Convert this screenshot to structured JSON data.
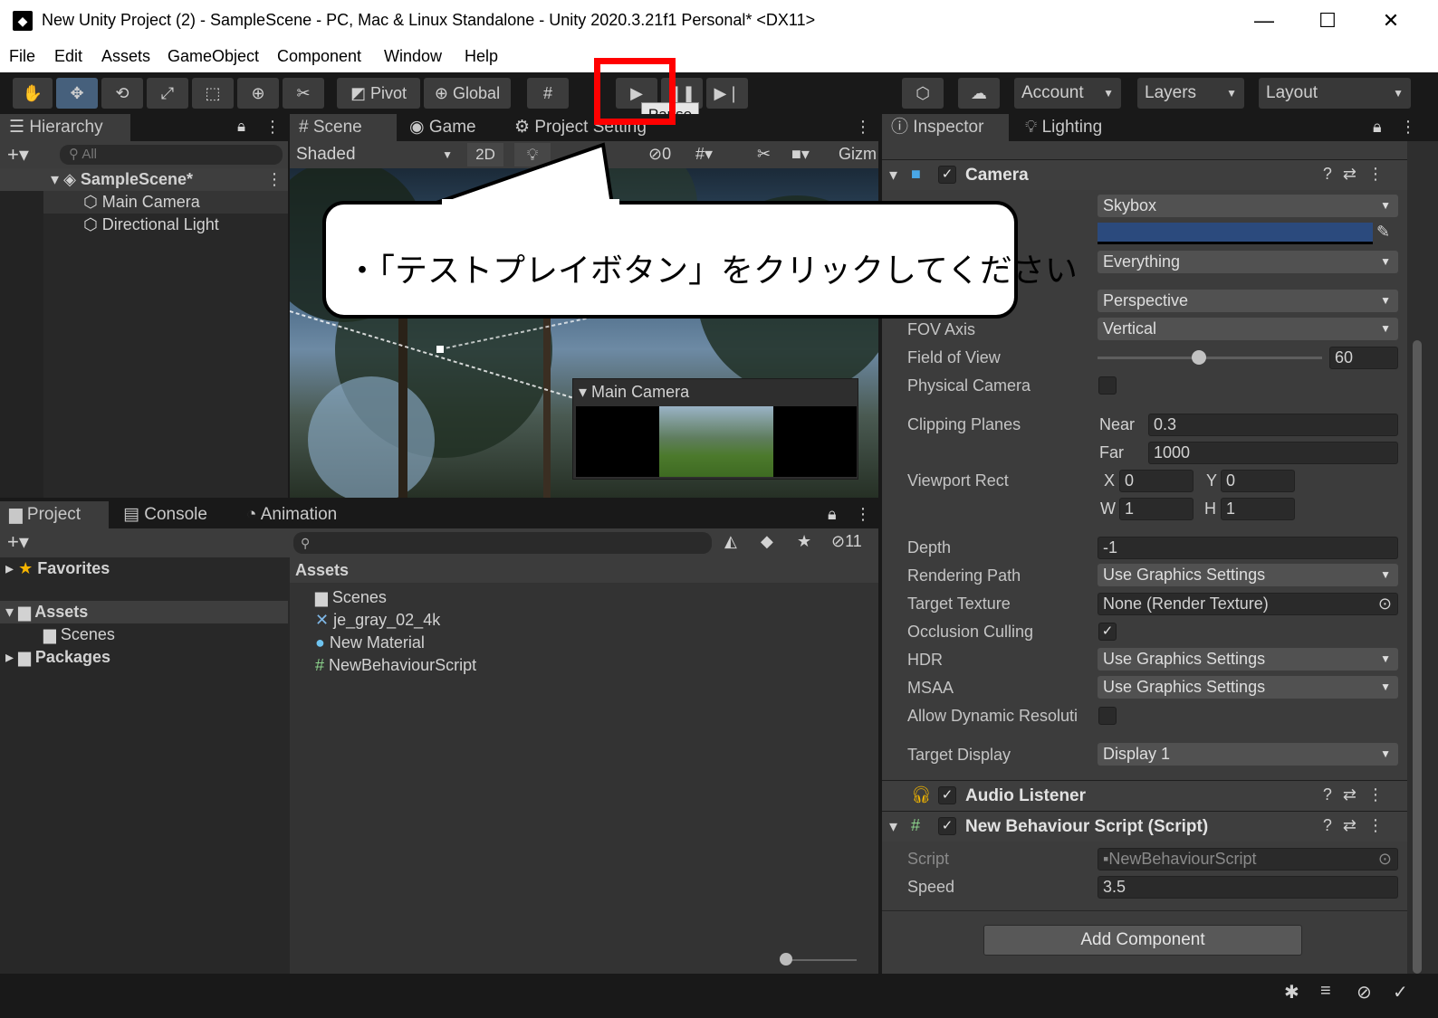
{
  "window": {
    "title": "New Unity Project (2) - SampleScene - PC, Mac & Linux Standalone - Unity 2020.3.21f1 Personal* <DX11>",
    "controls": [
      "—",
      "☐",
      "✕"
    ]
  },
  "menu": [
    "File",
    "Edit",
    "Assets",
    "GameObject",
    "Component",
    "Window",
    "Help"
  ],
  "toolbar": {
    "pivot": "Pivot",
    "global": "Global",
    "tooltip": "Pause",
    "account": "Account",
    "layers": "Layers",
    "layout": "Layout"
  },
  "hierarchy": {
    "tab": "Hierarchy",
    "search_placeholder": "All",
    "scene": "SampleScene*",
    "items": [
      "Main Camera",
      "Directional Light"
    ]
  },
  "scene_view": {
    "tabs": [
      "Scene",
      "Game",
      "Project Setting"
    ],
    "shading": "Shaded",
    "mode_2d": "2D",
    "hidden_count": "0",
    "gizmos": "Gizm",
    "preview_title": "Main Camera"
  },
  "project": {
    "tabs": [
      "Project",
      "Console",
      "Animation"
    ],
    "hidden_count": "11",
    "tree": {
      "favorites": "Favorites",
      "assets": "Assets",
      "scenes": "Scenes",
      "packages": "Packages"
    },
    "breadcrumb": "Assets",
    "files": [
      "Scenes",
      "je_gray_02_4k",
      "New Material",
      "NewBehaviourScript"
    ]
  },
  "inspector": {
    "tabs": [
      "Inspector",
      "Lighting"
    ],
    "camera": {
      "header": "Camera",
      "clear_flags": "Skybox",
      "background_color": "#2b4a7d",
      "culling_mask": "Everything",
      "projection": "Perspective",
      "fov_axis_label": "FOV Axis",
      "fov_axis": "Vertical",
      "fov_label": "Field of View",
      "fov_value": "60",
      "fov_slider": 0.45,
      "physical_label": "Physical Camera",
      "clipping_label": "Clipping Planes",
      "near_label": "Near",
      "near": "0.3",
      "far_label": "Far",
      "far": "1000",
      "viewport_label": "Viewport Rect",
      "x_label": "X",
      "x": "0",
      "y_label": "Y",
      "y": "0",
      "w_label": "W",
      "w": "1",
      "h_label": "H",
      "h": "1",
      "depth_label": "Depth",
      "depth": "-1",
      "rendering_label": "Rendering Path",
      "rendering": "Use Graphics Settings",
      "target_texture_label": "Target Texture",
      "target_texture": "None (Render Texture)",
      "occlusion_label": "Occlusion Culling",
      "hdr_label": "HDR",
      "hdr": "Use Graphics Settings",
      "msaa_label": "MSAA",
      "msaa": "Use Graphics Settings",
      "dynamic_label": "Allow Dynamic Resoluti",
      "display_label": "Target Display",
      "display": "Display 1"
    },
    "audio_listener": "Audio Listener",
    "script_comp": {
      "header": "New Behaviour Script (Script)",
      "script_label": "Script",
      "script": "NewBehaviourScript",
      "speed_label": "Speed",
      "speed": "3.5"
    },
    "add_component": "Add Component"
  },
  "callout": {
    "text": "・「テストプレイボタン」をクリックしてください"
  }
}
